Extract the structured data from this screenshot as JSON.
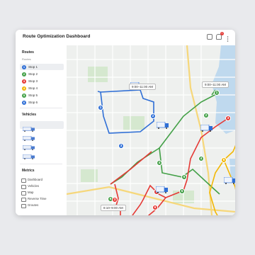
{
  "app": {
    "title": "Route Optimization Dashboard",
    "notification_count": "1"
  },
  "routes": {
    "heading": "Routes",
    "subheading": "Routes",
    "items": [
      {
        "num": "1",
        "label": "Stop 1",
        "color": "#2f6fd6"
      },
      {
        "num": "2",
        "label": "Stop 2",
        "color": "#43a047"
      },
      {
        "num": "3",
        "label": "Stop 3",
        "color": "#e53935"
      },
      {
        "num": "4",
        "label": "Stop 4",
        "color": "#f2b705"
      },
      {
        "num": "5",
        "label": "Stop 5",
        "color": "#43a047"
      },
      {
        "num": "6",
        "label": "Stop 6",
        "color": "#2f6fd6"
      }
    ]
  },
  "vehicles": {
    "heading": "Vehicles"
  },
  "metrics": {
    "heading": "Metrics",
    "items": [
      {
        "label": "Dashboard"
      },
      {
        "label": "Vehicles"
      },
      {
        "label": "Map"
      },
      {
        "label": "Reverse Time"
      },
      {
        "label": "Groutes"
      }
    ]
  },
  "map": {
    "time_windows": [
      "9:00–11:00 AM",
      "9:00–11:00 AM",
      "8:10–9:00 AM"
    ],
    "route_colors": {
      "blue": "#2f6fd6",
      "green": "#43a047",
      "red": "#e53935",
      "yellow": "#f2b705"
    },
    "stop_labels": [
      "1",
      "2",
      "3",
      "4",
      "5",
      "6",
      "7",
      "8"
    ]
  }
}
